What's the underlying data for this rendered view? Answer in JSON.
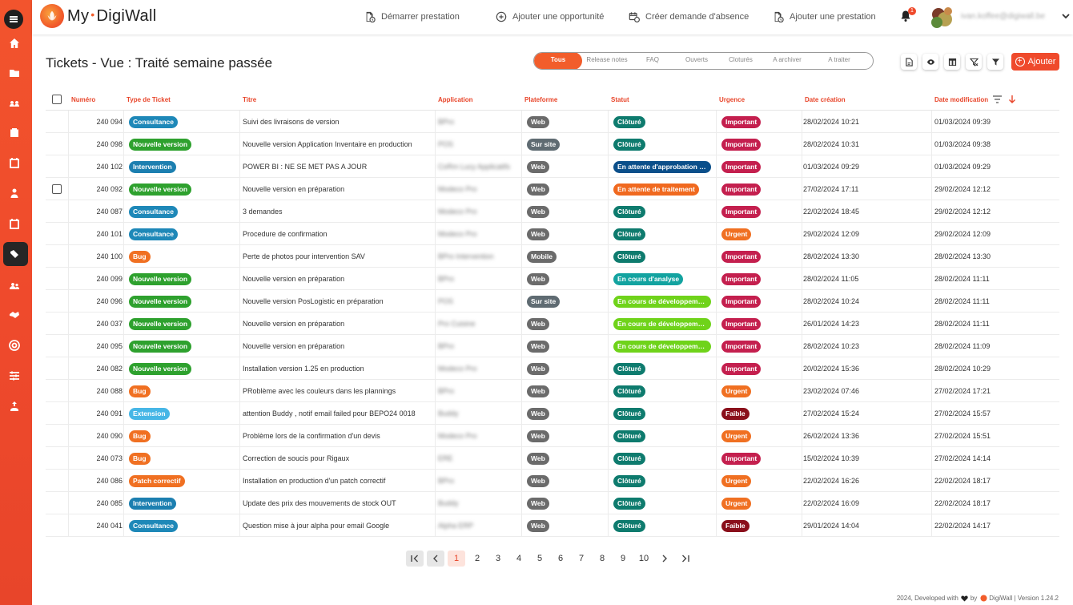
{
  "app": {
    "logo_text_a": "My",
    "logo_dot": "•",
    "logo_text_b": "DigiWall",
    "notifications_count": "1",
    "user_email": "ivan.koffee@digiwall.be"
  },
  "topbar": {
    "actions": [
      {
        "label": "Démarrer prestation",
        "icon": "file-clock-icon"
      },
      {
        "label": "Ajouter une opportunité",
        "icon": "plus-circle-icon"
      },
      {
        "label": "Créer demande d'absence",
        "icon": "calendar-clock-icon"
      },
      {
        "label": "Ajouter une prestation",
        "icon": "file-clock-icon"
      }
    ]
  },
  "sidebar": {
    "items": [
      "home-icon",
      "folder-icon",
      "users-gear-icon",
      "clipboard-icon",
      "calendar-icon",
      "user-tie-icon",
      "calendar-check-icon",
      "tickets-icon",
      "team-icon",
      "handshake-icon",
      "settings-circle-icon",
      "sliders-icon",
      "user-upload-icon"
    ]
  },
  "page": {
    "title": "Tickets - Vue : Traité semaine passée",
    "filters": [
      "Tous",
      "Release notes",
      "FAQ",
      "Ouverts",
      "Cloturés",
      "A archiver",
      "A traiter"
    ],
    "active_filter": "Tous",
    "add_label": "Ajouter"
  },
  "colors": {
    "accent": "#ef4a2c",
    "Consultance": "#1e88b8",
    "Nouvelle version": "#2ea12e",
    "Intervention": "#1c7fb0",
    "Bug": "#f07022",
    "Extension": "#46b6e6",
    "Patch correctif": "#f07022",
    "Web": "#6b6b6b",
    "Sur site": "#5f6b72",
    "Mobile": "#6b6b6b",
    "Clôturé": "#0e7b6e",
    "En attente d'approbation d...": "#0b4f8a",
    "En attente de traitement": "#f0691f",
    "En cours d'analyse": "#13a3a0",
    "En cours de développement": "#6fd31a",
    "Important": "#c41f4e",
    "Urgent": "#f07022",
    "Faible": "#8a0f1b"
  },
  "table": {
    "headers": {
      "numero": "Numéro",
      "type": "Type de Ticket",
      "titre": "Titre",
      "application": "Application",
      "plateforme": "Plateforme",
      "statut": "Statut",
      "urgence": "Urgence",
      "date_creation": "Date création",
      "date_modification": "Date modification"
    },
    "rows": [
      {
        "num": "240 094",
        "type": "Consultance",
        "titre": "Suivi des livraisons de version",
        "app": "BPro",
        "plat": "Web",
        "statut": "Clôturé",
        "urg": "Important",
        "created": "28/02/2024 10:21",
        "modified": "01/03/2024 09:39",
        "checkbox": false
      },
      {
        "num": "240 098",
        "type": "Nouvelle version",
        "titre": "Nouvelle version Application Inventaire en production",
        "app": "POS",
        "plat": "Sur site",
        "statut": "Clôturé",
        "urg": "Important",
        "created": "28/02/2024 10:31",
        "modified": "01/03/2024 09:38",
        "checkbox": false
      },
      {
        "num": "240 102",
        "type": "Intervention",
        "titre": "POWER BI : NE SE MET PAS A JOUR",
        "app": "CoRm Lucy Applicatifs",
        "plat": "Web",
        "statut": "En attente d'approbation d...",
        "urg": "Important",
        "created": "01/03/2024 09:29",
        "modified": "01/03/2024 09:29",
        "checkbox": false
      },
      {
        "num": "240 092",
        "type": "Nouvelle version",
        "titre": "Nouvelle version en préparation",
        "app": "Modeco Pro",
        "plat": "Web",
        "statut": "En attente de traitement",
        "urg": "Important",
        "created": "27/02/2024 17:11",
        "modified": "29/02/2024 12:12",
        "checkbox": true
      },
      {
        "num": "240 087",
        "type": "Consultance",
        "titre": "3 demandes",
        "app": "Modeco Pro",
        "plat": "Web",
        "statut": "Clôturé",
        "urg": "Important",
        "created": "22/02/2024 18:45",
        "modified": "29/02/2024 12:12",
        "checkbox": false
      },
      {
        "num": "240 101",
        "type": "Consultance",
        "titre": "Procedure de confirmation",
        "app": "Modeco Pro",
        "plat": "Web",
        "statut": "Clôturé",
        "urg": "Urgent",
        "created": "29/02/2024 12:09",
        "modified": "29/02/2024 12:09",
        "checkbox": false
      },
      {
        "num": "240 100",
        "type": "Bug",
        "titre": "Perte de photos pour intervention SAV",
        "app": "BPro Intervention",
        "plat": "Mobile",
        "statut": "Clôturé",
        "urg": "Important",
        "created": "28/02/2024 13:30",
        "modified": "28/02/2024 13:30",
        "checkbox": false
      },
      {
        "num": "240 099",
        "type": "Nouvelle version",
        "titre": "Nouvelle version en préparation",
        "app": "BPro",
        "plat": "Web",
        "statut": "En cours d'analyse",
        "urg": "Important",
        "created": "28/02/2024 11:05",
        "modified": "28/02/2024 11:11",
        "checkbox": false
      },
      {
        "num": "240 096",
        "type": "Nouvelle version",
        "titre": "Nouvelle version PosLogistic en préparation",
        "app": "POS",
        "plat": "Sur site",
        "statut": "En cours de développement",
        "urg": "Important",
        "created": "28/02/2024 10:24",
        "modified": "28/02/2024 11:11",
        "checkbox": false
      },
      {
        "num": "240 037",
        "type": "Nouvelle version",
        "titre": "Nouvelle version en préparation",
        "app": "Pro Cuisine",
        "plat": "Web",
        "statut": "En cours de développement",
        "urg": "Important",
        "created": "26/01/2024 14:23",
        "modified": "28/02/2024 11:11",
        "checkbox": false
      },
      {
        "num": "240 095",
        "type": "Nouvelle version",
        "titre": "Nouvelle version en préparation",
        "app": "BPro",
        "plat": "Web",
        "statut": "En cours de développement",
        "urg": "Important",
        "created": "28/02/2024 10:23",
        "modified": "28/02/2024 11:09",
        "checkbox": false
      },
      {
        "num": "240 082",
        "type": "Nouvelle version",
        "titre": "Installation version 1.25 en production",
        "app": "Modeco Pro",
        "plat": "Web",
        "statut": "Clôturé",
        "urg": "Important",
        "created": "20/02/2024 15:36",
        "modified": "28/02/2024 10:29",
        "checkbox": false
      },
      {
        "num": "240 088",
        "type": "Bug",
        "titre": "PRoblème avec les couleurs dans les plannings",
        "app": "BPro",
        "plat": "Web",
        "statut": "Clôturé",
        "urg": "Urgent",
        "created": "23/02/2024 07:46",
        "modified": "27/02/2024 17:21",
        "checkbox": false
      },
      {
        "num": "240 091",
        "type": "Extension",
        "titre": "attention Buddy , notif email failed pour BEPO24 0018",
        "app": "Buddy",
        "plat": "Web",
        "statut": "Clôturé",
        "urg": "Faible",
        "created": "27/02/2024 15:24",
        "modified": "27/02/2024 15:57",
        "checkbox": false
      },
      {
        "num": "240 090",
        "type": "Bug",
        "titre": "Problème lors de la confirmation d'un devis",
        "app": "Modeco Pro",
        "plat": "Web",
        "statut": "Clôturé",
        "urg": "Urgent",
        "created": "26/02/2024 13:36",
        "modified": "27/02/2024 15:51",
        "checkbox": false
      },
      {
        "num": "240 073",
        "type": "Bug",
        "titre": "Correction de soucis pour Rigaux",
        "app": "ERE",
        "plat": "Web",
        "statut": "Clôturé",
        "urg": "Important",
        "created": "15/02/2024 10:39",
        "modified": "27/02/2024 14:14",
        "checkbox": false
      },
      {
        "num": "240 086",
        "type": "Patch correctif",
        "titre": "Installation en production d'un patch correctif",
        "app": "BPro",
        "plat": "Web",
        "statut": "Clôturé",
        "urg": "Urgent",
        "created": "22/02/2024 16:26",
        "modified": "22/02/2024 18:17",
        "checkbox": false
      },
      {
        "num": "240 085",
        "type": "Intervention",
        "titre": "Update des prix des mouvements de stock OUT",
        "app": "Buddy",
        "plat": "Web",
        "statut": "Clôturé",
        "urg": "Urgent",
        "created": "22/02/2024 16:09",
        "modified": "22/02/2024 18:17",
        "checkbox": false
      },
      {
        "num": "240 041",
        "type": "Consultance",
        "titre": "Question mise à jour alpha pour email Google",
        "app": "Alpha ERP",
        "plat": "Web",
        "statut": "Clôturé",
        "urg": "Faible",
        "created": "29/01/2024 14:04",
        "modified": "22/02/2024 14:17",
        "checkbox": false
      }
    ]
  },
  "pagination": {
    "pages": [
      "1",
      "2",
      "3",
      "4",
      "5",
      "6",
      "7",
      "8",
      "9",
      "10"
    ],
    "active": "1"
  },
  "footer": {
    "text_a": "2024, Developed with",
    "text_b": "by",
    "brand": "DigiWall",
    "version": "| Version 1.24.2"
  }
}
